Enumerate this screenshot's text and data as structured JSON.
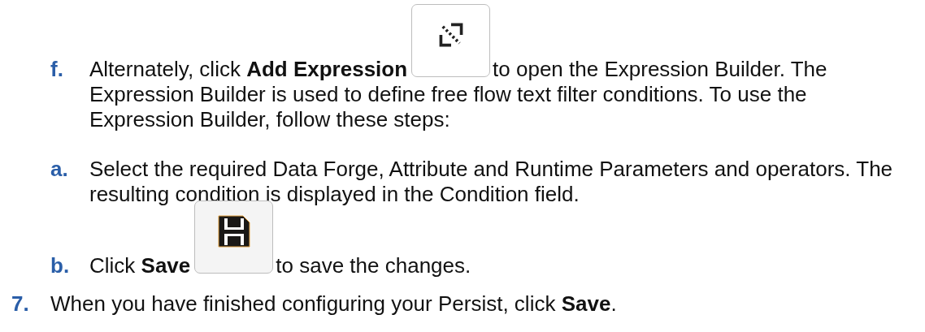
{
  "substeps": [
    {
      "marker": "f.",
      "segments": [
        {
          "kind": "text",
          "text": "Alternately, click **Add Expression**"
        },
        {
          "kind": "expression-button"
        },
        {
          "kind": "text",
          "text": "to open the Expression Builder. The"
        }
      ],
      "rest": "Expression Builder is used to define free flow text filter conditions. To use the Expression Builder, follow these steps:"
    },
    {
      "marker": "a.",
      "segments": [
        {
          "kind": "text",
          "text": "Select the required Data Forge, Attribute and Runtime Parameters and operators. The resulting condition is displayed in the Condition field."
        }
      ]
    },
    {
      "marker": "b.",
      "segments": [
        {
          "kind": "text",
          "text": "Click **Save**"
        },
        {
          "kind": "save-button"
        },
        {
          "kind": "text",
          "text": "to save the changes."
        }
      ]
    }
  ],
  "steps": [
    {
      "marker": "7.",
      "segments": [
        {
          "kind": "text",
          "text": "When you have finished configuring your Persist, click **Save**."
        }
      ]
    }
  ]
}
